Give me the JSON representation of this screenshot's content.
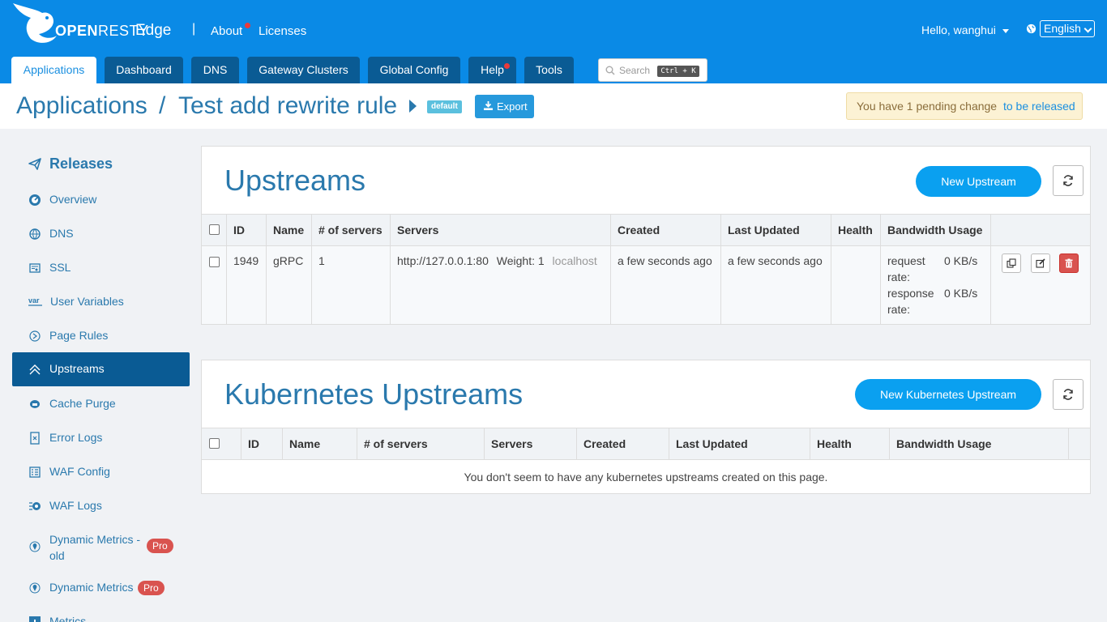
{
  "topbar": {
    "logo_text_bold": "OPEN",
    "logo_text_light": "RESTY",
    "product": "Edge",
    "separator": "|",
    "links": {
      "about": "About",
      "licenses": "Licenses"
    },
    "user_greeting": "Hello, wanghui",
    "language": "English",
    "search": {
      "placeholder": "Search",
      "shortcut": "Ctrl + K"
    }
  },
  "tabs": [
    {
      "label": "Applications",
      "active": true
    },
    {
      "label": "Dashboard"
    },
    {
      "label": "DNS"
    },
    {
      "label": "Gateway Clusters"
    },
    {
      "label": "Global Config"
    },
    {
      "label": "Help",
      "dot": true
    },
    {
      "label": "Tools"
    }
  ],
  "header": {
    "breadcrumb_root": "Applications",
    "breadcrumb_sep": "/",
    "app_name": "Test add rewrite rule",
    "partition_badge": "default",
    "export_label": "Export",
    "pending_text": "You have 1 pending change",
    "pending_link": "to be released"
  },
  "sidebar": {
    "title": "Releases",
    "items": [
      {
        "label": "Overview",
        "icon": "dashboard-icon"
      },
      {
        "label": "DNS",
        "icon": "globe-icon"
      },
      {
        "label": "SSL",
        "icon": "certificate-icon"
      },
      {
        "label": "User Variables",
        "icon": "var-icon"
      },
      {
        "label": "Page Rules",
        "icon": "rules-icon"
      },
      {
        "label": "Upstreams",
        "icon": "upstream-icon",
        "active": true
      },
      {
        "label": "Cache Purge",
        "icon": "cache-icon"
      },
      {
        "label": "Error Logs",
        "icon": "error-log-icon"
      },
      {
        "label": "WAF Config",
        "icon": "waf-config-icon"
      },
      {
        "label": "WAF Logs",
        "icon": "waf-logs-icon"
      },
      {
        "label_line1": "Dynamic Metrics -",
        "label_line2": "old",
        "icon": "metrics-icon",
        "badge": "Pro"
      },
      {
        "label": "Dynamic Metrics",
        "icon": "metrics-icon",
        "badge": "Pro"
      },
      {
        "label": "Metrics",
        "icon": "chart-icon"
      }
    ]
  },
  "upstreams": {
    "title": "Upstreams",
    "new_button": "New Upstream",
    "columns": [
      "ID",
      "Name",
      "# of servers",
      "Servers",
      "Created",
      "Last Updated",
      "Health",
      "Bandwidth Usage"
    ],
    "rows": [
      {
        "id": "1949",
        "name": "gRPC",
        "num_servers": "1",
        "server_addr": "http://127.0.0.1:80",
        "server_weight": "Weight: 1",
        "server_host": "localhost",
        "created": "a few seconds ago",
        "updated": "a few seconds ago",
        "health": "",
        "req_label_1": "request",
        "req_label_2": "rate:",
        "req_value": "0 KB/s",
        "resp_label_1": "response",
        "resp_label_2": "rate:",
        "resp_value": "0 KB/s"
      }
    ]
  },
  "k8s_upstreams": {
    "title": "Kubernetes Upstreams",
    "new_button": "New Kubernetes Upstream",
    "columns": [
      "ID",
      "Name",
      "# of servers",
      "Servers",
      "Created",
      "Last Updated",
      "Health",
      "Bandwidth Usage"
    ],
    "empty_text": "You don't seem to have any kubernetes upstreams created on this page."
  },
  "colors": {
    "brand": "#0a8ae6",
    "active_nav": "#0a5b94",
    "link": "#2a79ad",
    "danger": "#d9534f"
  }
}
